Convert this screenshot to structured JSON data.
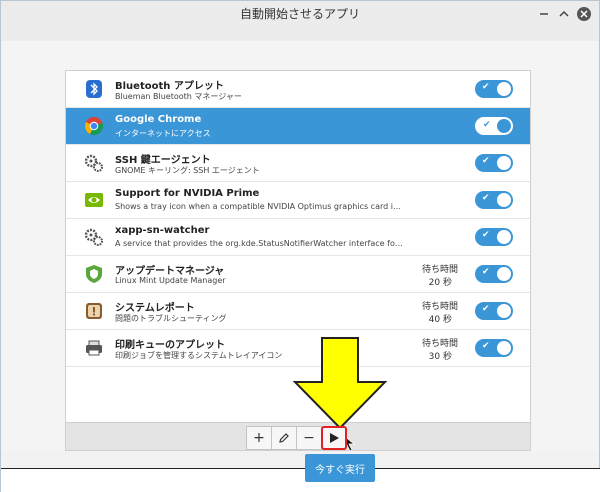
{
  "window": {
    "title": "自動開始させるアプリ",
    "buttons": [
      "minimize-icon",
      "maximize-icon",
      "close-icon"
    ]
  },
  "apps": [
    {
      "name": "Bluetooth アプレット",
      "desc": "Blueman Bluetooth マネージャー",
      "icon": "bluetooth-icon",
      "enabled": true,
      "selected": false
    },
    {
      "name": "Google Chrome",
      "desc": "インターネットにアクセス",
      "icon": "chrome-icon",
      "enabled": true,
      "selected": true
    },
    {
      "name": "SSH 鍵エージェント",
      "desc": "GNOME キーリング: SSH エージェント",
      "icon": "gears-icon",
      "enabled": true,
      "selected": false
    },
    {
      "name": "Support for NVIDIA Prime",
      "desc": "Shows a tray icon when a compatible NVIDIA Optimus graphics card is det...",
      "icon": "nvidia-icon",
      "enabled": true,
      "selected": false
    },
    {
      "name": "xapp-sn-watcher",
      "desc": "A service that provides the org.kde.StatusNotifierWatcher interface for XA...",
      "icon": "gears-icon",
      "enabled": true,
      "selected": false
    },
    {
      "name": "アップデートマネージャ",
      "desc": "Linux Mint Update Manager",
      "icon": "shield-icon",
      "enabled": true,
      "selected": false,
      "delay_label": "待ち時間",
      "delay_value": "20 秒"
    },
    {
      "name": "システムレポート",
      "desc": "問題のトラブルシューティング",
      "icon": "report-icon",
      "enabled": true,
      "selected": false,
      "delay_label": "待ち時間",
      "delay_value": "40 秒"
    },
    {
      "name": "印刷キューのアプレット",
      "desc": "印刷ジョブを管理するシステムトレイアイコン",
      "icon": "printer-icon",
      "enabled": true,
      "selected": false,
      "delay_label": "待ち時間",
      "delay_value": "30 秒"
    }
  ],
  "toolbar": {
    "add": "+",
    "edit_icon": "pencil-icon",
    "remove": "−",
    "run_icon": "play-icon"
  },
  "run_now_label": "今すぐ実行",
  "colors": {
    "accent": "#3b96d7",
    "highlight_border": "#e22222",
    "arrow_fill": "#ffff00"
  }
}
